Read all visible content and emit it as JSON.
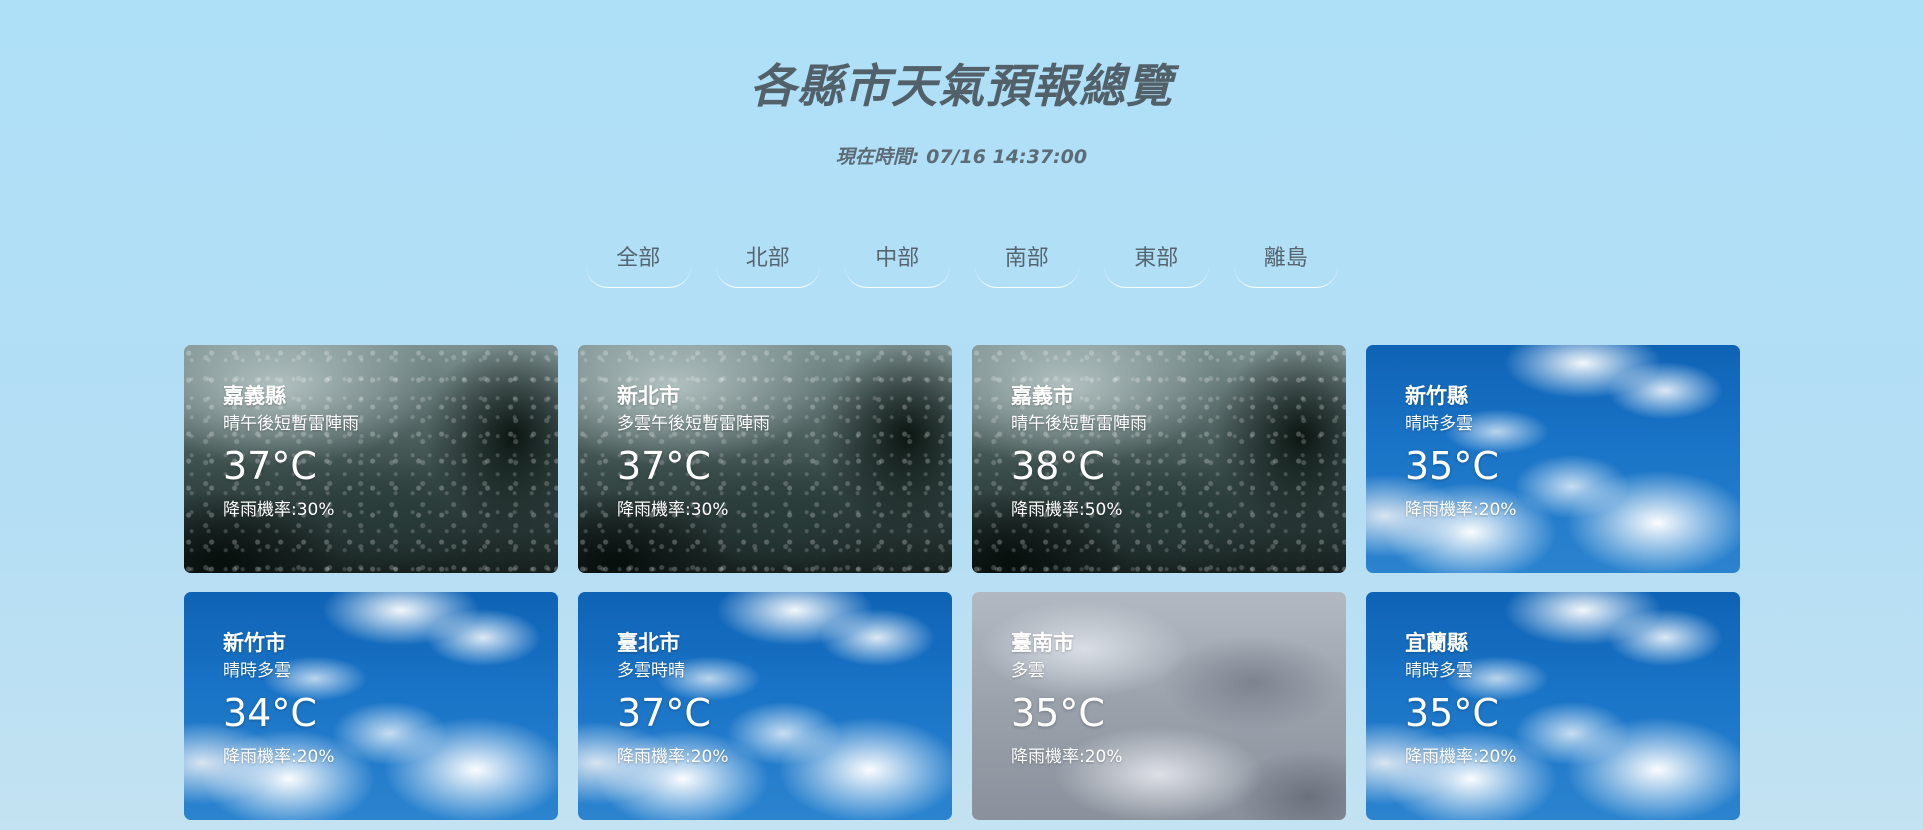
{
  "header": {
    "title": "各縣市天氣預報總覽",
    "current_time": "現在時間: 07/16 14:37:00"
  },
  "tabs": [
    {
      "label": "全部"
    },
    {
      "label": "北部"
    },
    {
      "label": "中部"
    },
    {
      "label": "南部"
    },
    {
      "label": "東部"
    },
    {
      "label": "離島"
    }
  ],
  "cards": [
    {
      "city": "嘉義縣",
      "desc": "晴午後短暫雷陣雨",
      "temp": "37°C",
      "rain": "降雨機率:30%",
      "background": "rain"
    },
    {
      "city": "新北市",
      "desc": "多雲午後短暫雷陣雨",
      "temp": "37°C",
      "rain": "降雨機率:30%",
      "background": "rain"
    },
    {
      "city": "嘉義市",
      "desc": "晴午後短暫雷陣雨",
      "temp": "38°C",
      "rain": "降雨機率:50%",
      "background": "rain"
    },
    {
      "city": "新竹縣",
      "desc": "晴時多雲",
      "temp": "35°C",
      "rain": "降雨機率:20%",
      "background": "sky"
    },
    {
      "city": "新竹市",
      "desc": "晴時多雲",
      "temp": "34°C",
      "rain": "降雨機率:20%",
      "background": "sky"
    },
    {
      "city": "臺北市",
      "desc": "多雲時晴",
      "temp": "37°C",
      "rain": "降雨機率:20%",
      "background": "sky"
    },
    {
      "city": "臺南市",
      "desc": "多雲",
      "temp": "35°C",
      "rain": "降雨機率:20%",
      "background": "cloudy"
    },
    {
      "city": "宜蘭縣",
      "desc": "晴時多雲",
      "temp": "35°C",
      "rain": "降雨機率:20%",
      "background": "sky"
    }
  ],
  "colors": {
    "page_background_top": "#aee0f8",
    "title_text": "#526069",
    "card_text": "#ffffff"
  }
}
